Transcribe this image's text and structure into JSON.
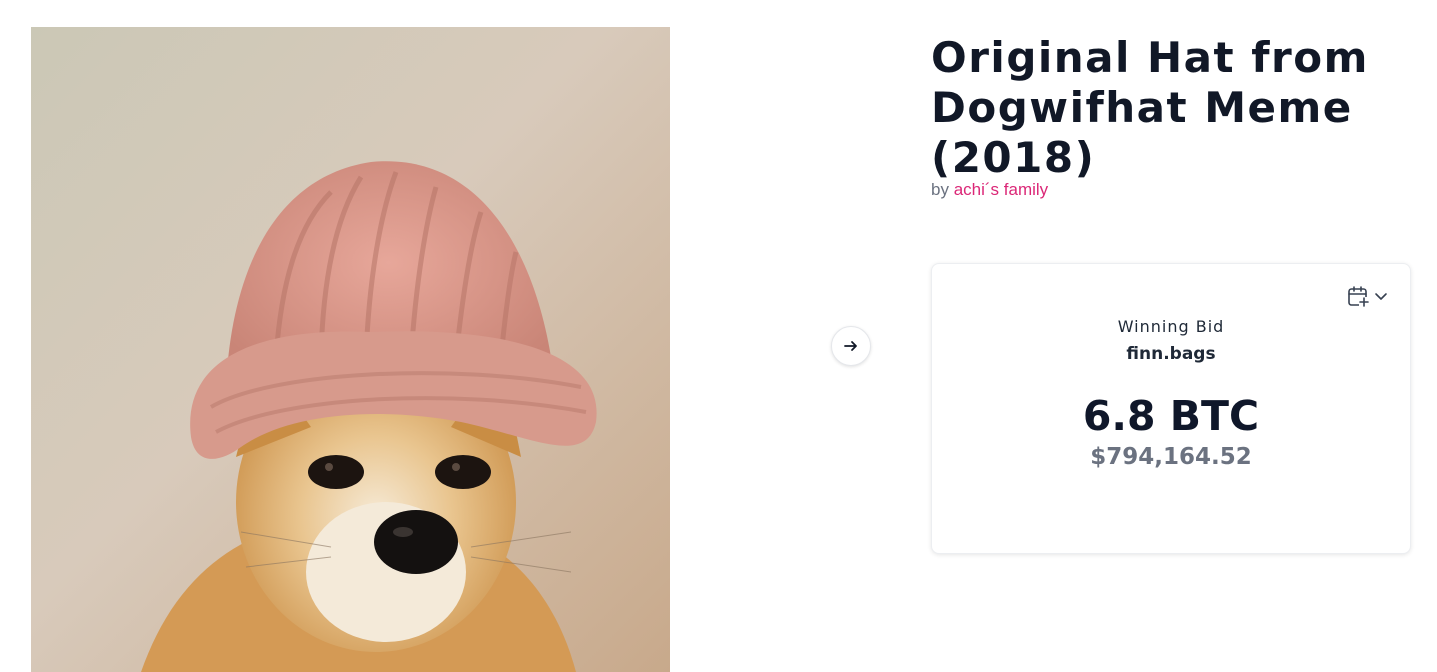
{
  "artwork": {
    "title": "Original Hat from Dogwifhat Meme (2018)",
    "by_prefix": "by",
    "artist": "achi´s family"
  },
  "navigation": {
    "next_icon": "arrow-right-icon"
  },
  "auction": {
    "status_label": "Winning Bid",
    "bidder": "finn.bags",
    "amount": "6.8 BTC",
    "amount_usd": "$794,164.52",
    "calendar_icon": "calendar-plus-icon",
    "dropdown_icon": "chevron-down-icon"
  },
  "colors": {
    "artist_link": "#db2777",
    "title_text": "#111827",
    "muted_text": "#6b7280"
  }
}
